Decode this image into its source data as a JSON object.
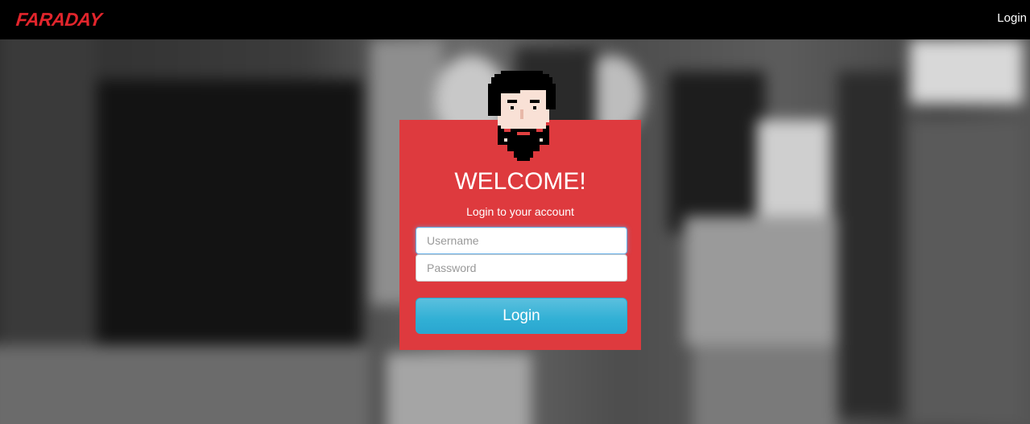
{
  "navbar": {
    "brand": "FARADAY",
    "login_link": "Login"
  },
  "login": {
    "title": "WELCOME!",
    "subtitle": "Login to your account",
    "username_placeholder": "Username",
    "password_placeholder": "Password",
    "submit_label": "Login"
  },
  "colors": {
    "navbar": "#000000",
    "brand": "#e1252c",
    "card": "#de3a3e",
    "button": "#31b0d5"
  },
  "icons": {
    "avatar": "pixel-art-bearded-man-avatar"
  }
}
